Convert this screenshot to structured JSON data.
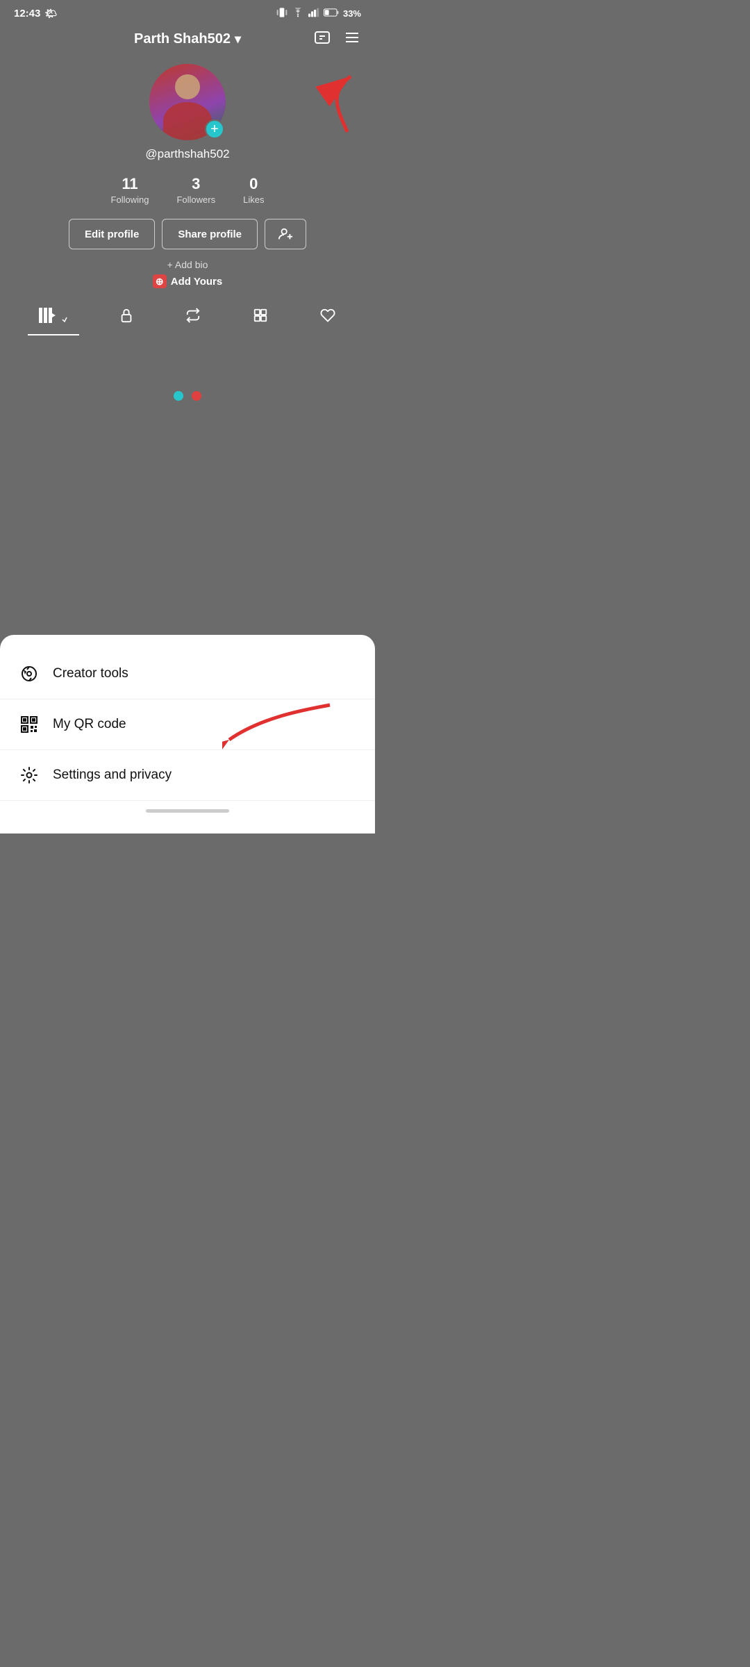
{
  "statusBar": {
    "time": "12:43",
    "battery": "33%"
  },
  "header": {
    "username": "Parth Shah502",
    "dropdown_arrow": "▾"
  },
  "profile": {
    "handle": "@parthshah502",
    "following_count": "11",
    "following_label": "Following",
    "followers_count": "3",
    "followers_label": "Followers",
    "likes_count": "0",
    "likes_label": "Likes"
  },
  "buttons": {
    "edit_profile": "Edit profile",
    "share_profile": "Share profile",
    "add_follow_icon": "person+"
  },
  "bio": {
    "add_bio": "+ Add bio",
    "add_yours": "Add Yours"
  },
  "bottomSheet": {
    "items": [
      {
        "id": "creator-tools",
        "label": "Creator tools"
      },
      {
        "id": "my-qr-code",
        "label": "My QR code"
      },
      {
        "id": "settings",
        "label": "Settings and privacy"
      }
    ]
  },
  "homeIndicator": ""
}
